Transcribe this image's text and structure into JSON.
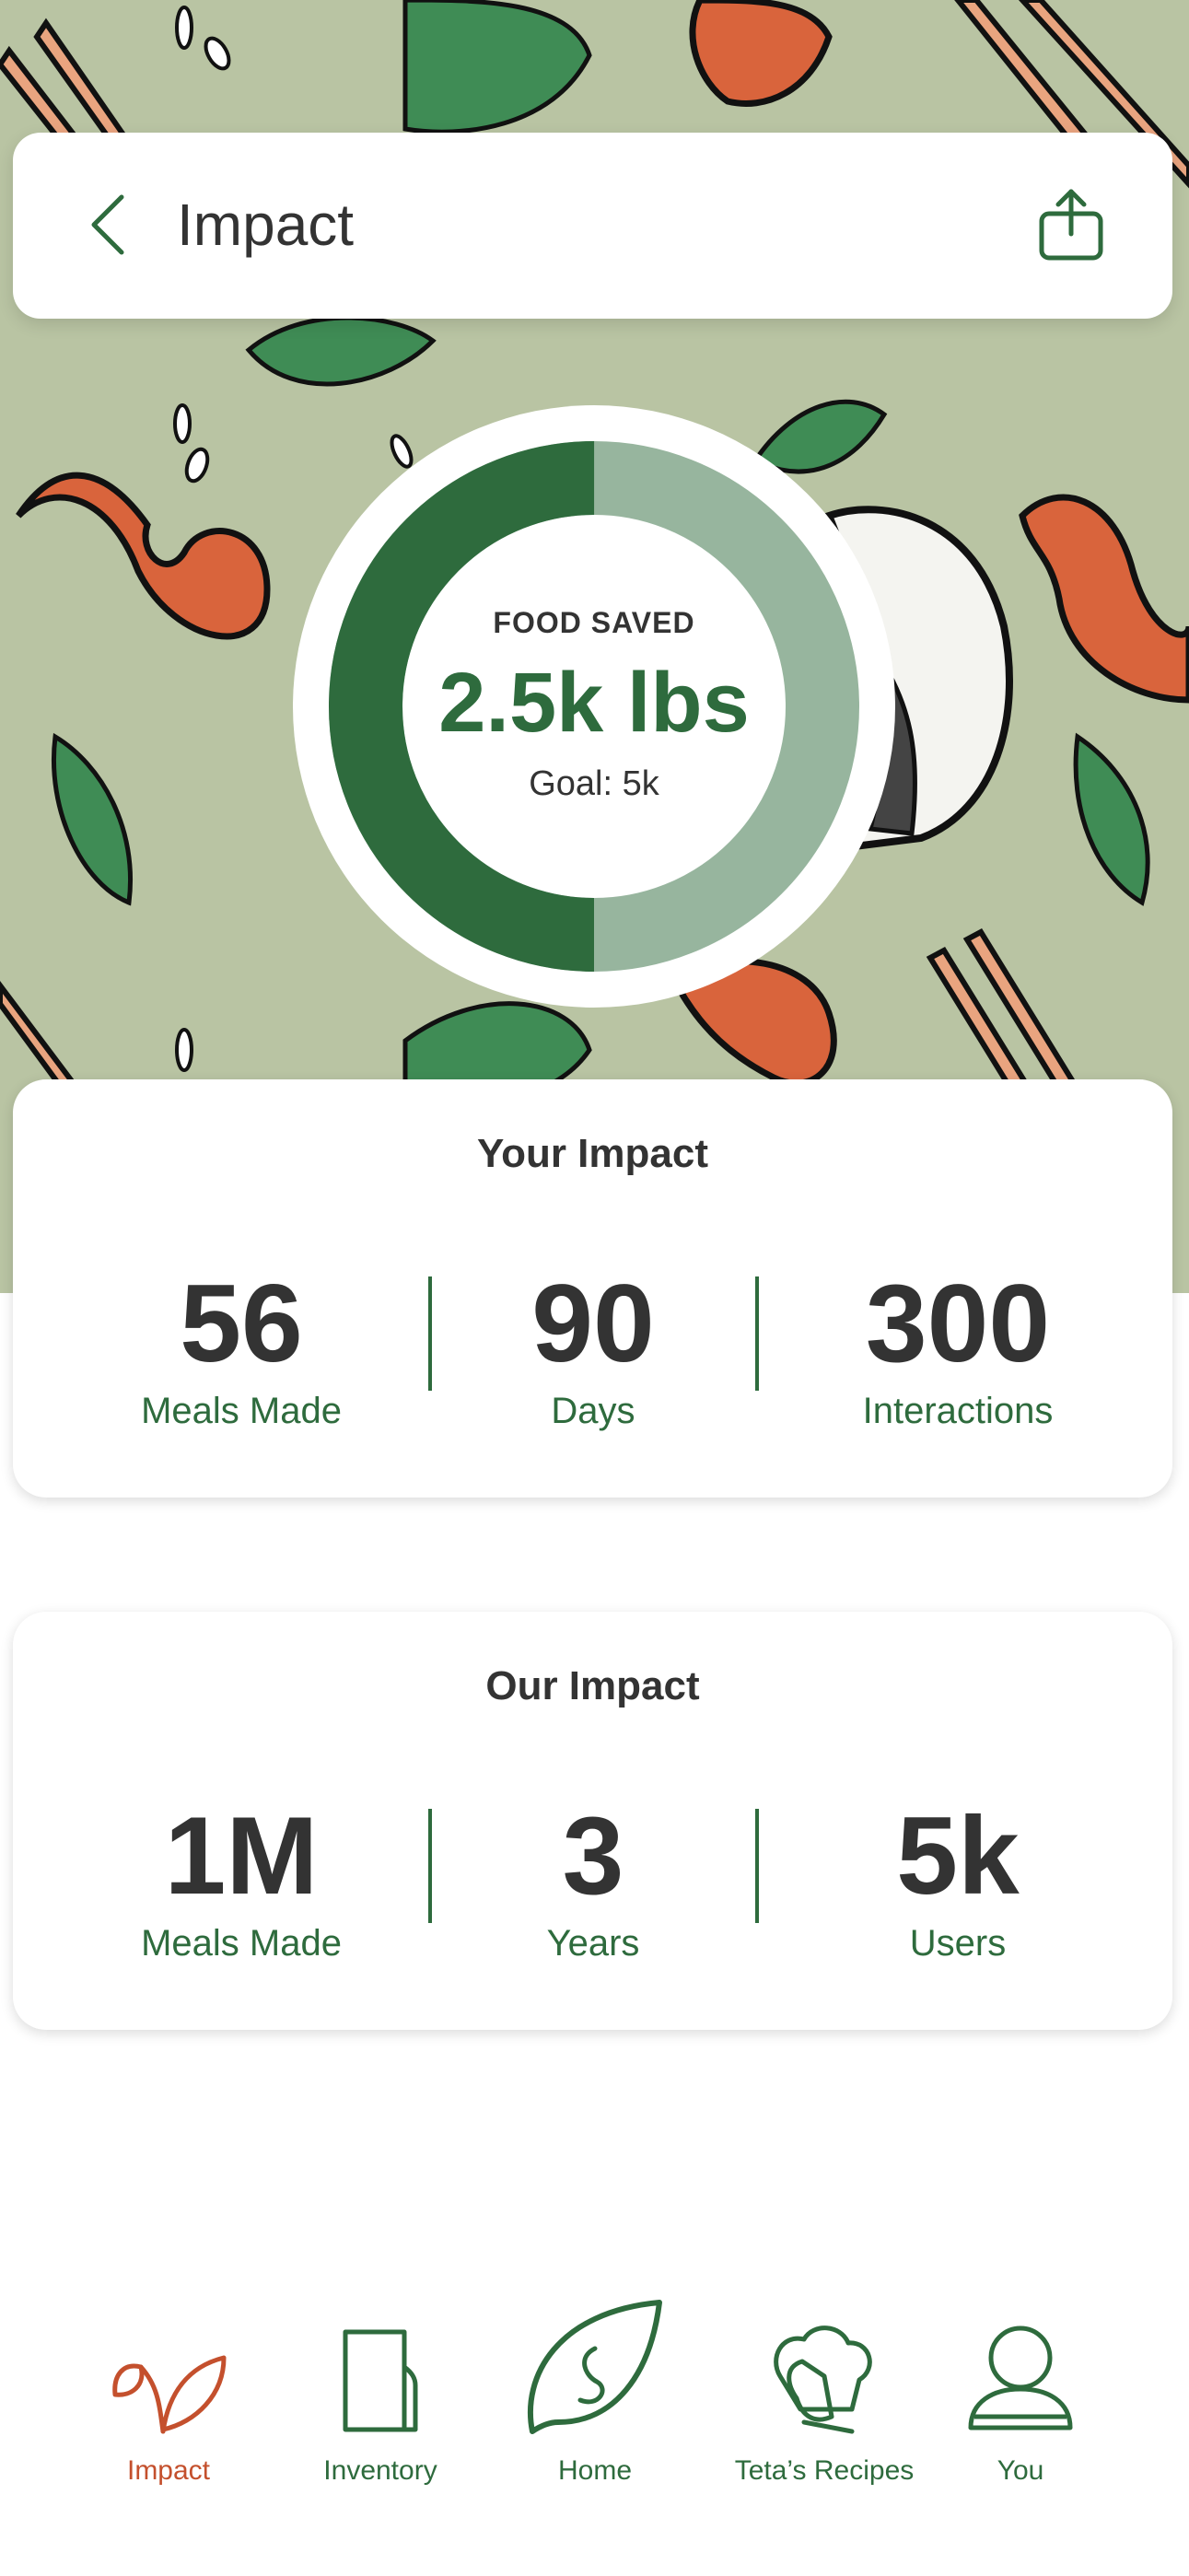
{
  "header": {
    "title": "Impact",
    "back_icon": "chevron-left-icon",
    "share_icon": "share-icon"
  },
  "gauge": {
    "label": "FOOD SAVED",
    "value_text": "2.5k lbs",
    "goal_text": "Goal: 5k",
    "progress_fraction": 0.5,
    "colors": {
      "filled": "#2e6b3d",
      "remaining": "#97b59e"
    }
  },
  "your_impact": {
    "title": "Your Impact",
    "stats": [
      {
        "value": "56",
        "label": "Meals Made"
      },
      {
        "value": "90",
        "label": "Days"
      },
      {
        "value": "300",
        "label": "Interactions"
      }
    ]
  },
  "our_impact": {
    "title": "Our Impact",
    "stats": [
      {
        "value": "1M",
        "label": "Meals Made"
      },
      {
        "value": "3",
        "label": "Years"
      },
      {
        "value": "5k",
        "label": "Users"
      }
    ]
  },
  "tabs": [
    {
      "label": "Impact",
      "icon": "sprout-icon",
      "active": true
    },
    {
      "label": "Inventory",
      "icon": "notebook-icon",
      "active": false
    },
    {
      "label": "Home",
      "icon": "leaf-logo-icon",
      "active": false
    },
    {
      "label": "Teta’s Recipes",
      "icon": "chef-hat-mitt-icon",
      "active": false
    },
    {
      "label": "You",
      "icon": "user-icon",
      "active": false
    }
  ],
  "colors": {
    "brand_green": "#2e6b3d",
    "accent_orange": "#c4502d",
    "hero_background": "#b9c4a3"
  }
}
